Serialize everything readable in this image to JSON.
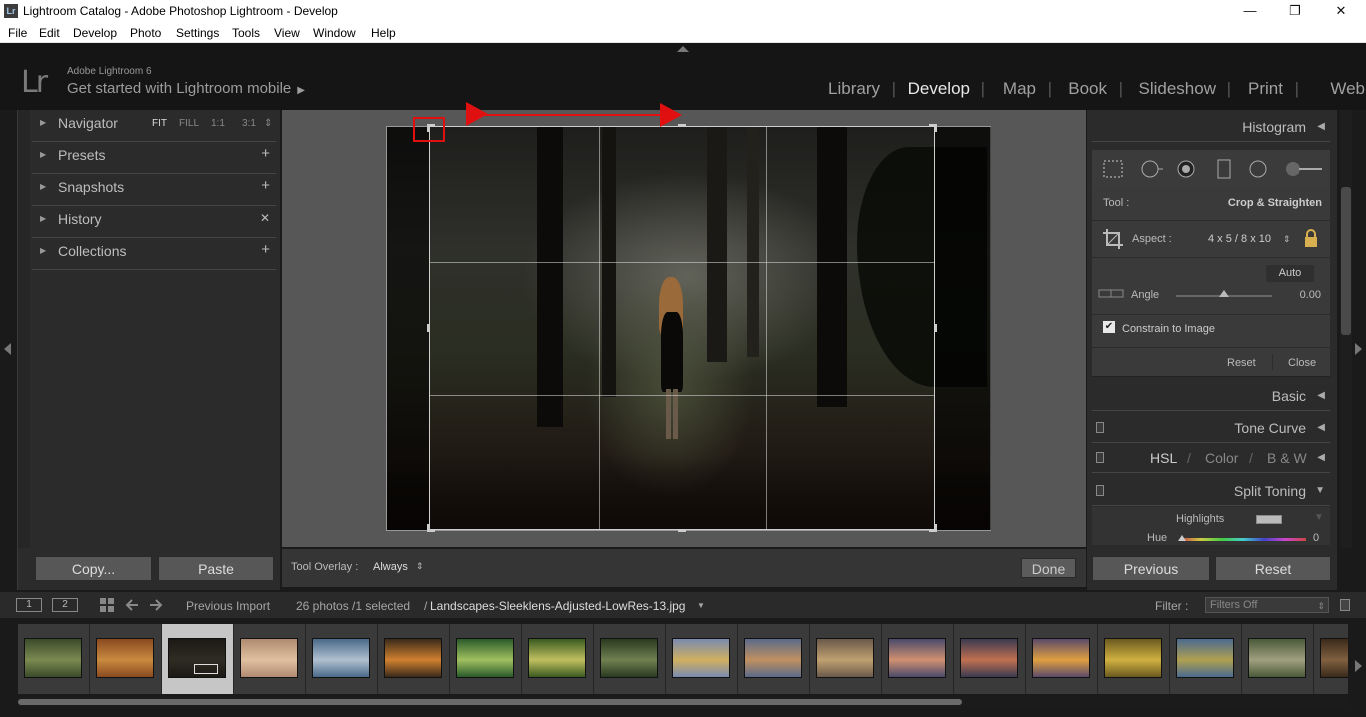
{
  "window": {
    "title": "Lightroom Catalog - Adobe Photoshop Lightroom - Develop",
    "app_icon": "Lr",
    "minimize": "—",
    "restore": "❐",
    "close": "✕"
  },
  "menu": [
    "File",
    "Edit",
    "Develop",
    "Photo",
    "Settings",
    "Tools",
    "View",
    "Window",
    "Help"
  ],
  "identity": {
    "logo": "Lr",
    "product": "Adobe Lightroom 6",
    "mobile": "Get started with Lightroom mobile",
    "mobile_arrow": "▶"
  },
  "modules": {
    "items": [
      "Library",
      "Develop",
      "Map",
      "Book",
      "Slideshow",
      "Print",
      "Web"
    ],
    "active": "Develop",
    "separator": "|"
  },
  "left_panel": {
    "sections": [
      {
        "label": "Navigator",
        "icon": "triangle-right"
      },
      {
        "label": "Presets",
        "action": "+"
      },
      {
        "label": "Snapshots",
        "action": "+"
      },
      {
        "label": "History",
        "action": "✕"
      },
      {
        "label": "Collections",
        "action": "+"
      }
    ],
    "navigator_zoom": [
      "FIT",
      "FILL",
      "1:1",
      "3:1"
    ],
    "zoom_stepper": "⇕",
    "copy_button": "Copy...",
    "paste_button": "Paste"
  },
  "toolbar": {
    "tool_overlay_label": "Tool Overlay :",
    "tool_overlay_value": "Always",
    "tool_overlay_stepper": "⇕",
    "done_button": "Done"
  },
  "right_panel": {
    "histogram": "Histogram",
    "tool_label": "Tool :",
    "tool_value": "Crop & Straighten",
    "aspect_label": "Aspect :",
    "aspect_value": "4 x 5  /  8 x 10",
    "aspect_stepper": "⇕",
    "auto_button": "Auto",
    "angle_label": "Angle",
    "angle_value": "0.00",
    "angle_level": 0.5,
    "constrain_label": "Constrain to Image",
    "constrain_checked": true,
    "checkmark": "✔",
    "reset_link": "Reset",
    "close_link": "Close",
    "basic": "Basic",
    "tone_curve": "Tone Curve",
    "hsl": "HSL",
    "color": "Color",
    "bw": "B & W",
    "slash": "/",
    "split_toning": "Split Toning",
    "highlights_label": "Highlights",
    "hue_label": "Hue",
    "hue_value": "0",
    "previous_button": "Previous",
    "reset_button": "Reset",
    "collapse_left": "◀",
    "expand_down": "▼"
  },
  "filmstrip_bar": {
    "monitor1": "1",
    "monitor2": "2",
    "previous_import": "Previous Import",
    "photo_count": "26 photos /1 selected",
    "filename_prefix": "/",
    "filename": "Landscapes-Sleeklens-Adjusted-LowRes-13.jpg",
    "filename_arrow": "▼",
    "filter_label": "Filter :",
    "filter_value": "Filters Off",
    "filter_stepper": "⇕"
  },
  "filmstrip": {
    "selected_index": 2,
    "thumbs": [
      {
        "name": "forest-landscape",
        "c1": "#3b4a2a",
        "c2": "#7a8a50"
      },
      {
        "name": "autumn-valley",
        "c1": "#8a4a20",
        "c2": "#c98a40"
      },
      {
        "name": "dark-forest-girl",
        "c1": "#1c1915",
        "c2": "#2f2c24"
      },
      {
        "name": "seaside-sunrise",
        "c1": "#b08a70",
        "c2": "#e0c0a0"
      },
      {
        "name": "coastal-rocks",
        "c1": "#4a6a8a",
        "c2": "#b0c0d0"
      },
      {
        "name": "river-sunset",
        "c1": "#3a2a1a",
        "c2": "#d08030"
      },
      {
        "name": "green-hills",
        "c1": "#2a5a2a",
        "c2": "#a0c060"
      },
      {
        "name": "forest-sunburst",
        "c1": "#3a5a20",
        "c2": "#c0c060"
      },
      {
        "name": "woodland-path",
        "c1": "#2a3a20",
        "c2": "#708050"
      },
      {
        "name": "misty-field",
        "c1": "#7a8ab0",
        "c2": "#d0b060"
      },
      {
        "name": "city-skyline",
        "c1": "#5a6a8a",
        "c2": "#c09060"
      },
      {
        "name": "venice-canal",
        "c1": "#6a5a4a",
        "c2": "#c0a070"
      },
      {
        "name": "venice-basilica",
        "c1": "#4a4a6a",
        "c2": "#d09070"
      },
      {
        "name": "gondolas-dusk",
        "c1": "#3a3a50",
        "c2": "#c07050"
      },
      {
        "name": "harbor-sunset",
        "c1": "#5a4a6a",
        "c2": "#e0a040"
      },
      {
        "name": "golden-mountains",
        "c1": "#6a5a20",
        "c2": "#d0b040"
      },
      {
        "name": "alpine-meadow",
        "c1": "#4a6a90",
        "c2": "#b0a050"
      },
      {
        "name": "rocky-hillside",
        "c1": "#4a5a3a",
        "c2": "#a0a080"
      },
      {
        "name": "dusk-partial",
        "c1": "#3a2a1a",
        "c2": "#806040"
      }
    ]
  }
}
